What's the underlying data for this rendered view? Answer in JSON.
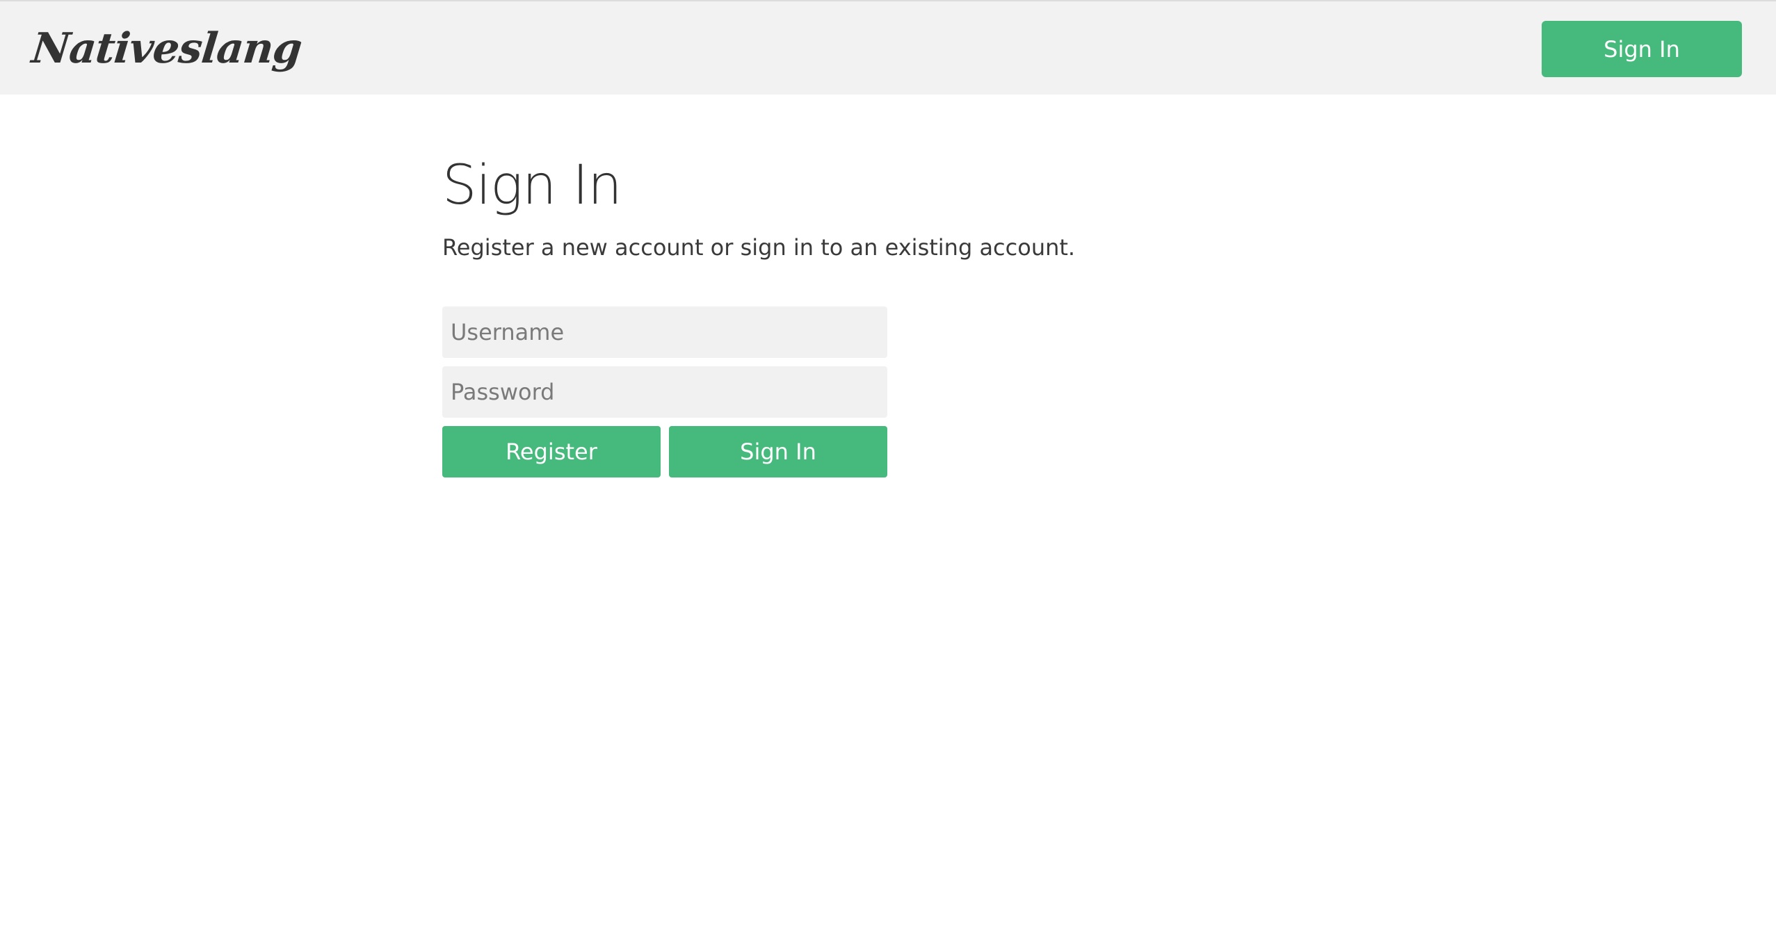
{
  "header": {
    "logo_text": "Nativeslang",
    "signin_label": "Sign In"
  },
  "main": {
    "title": "Sign In",
    "subtitle": "Register a new account or sign in to an existing account."
  },
  "form": {
    "username_placeholder": "Username",
    "username_value": "",
    "password_placeholder": "Password",
    "password_value": "",
    "register_label": "Register",
    "signin_label": "Sign In"
  },
  "colors": {
    "accent": "#46b97d",
    "navbar_bg": "#f2f2f2",
    "input_bg": "#f1f1f1",
    "text": "#333333"
  }
}
